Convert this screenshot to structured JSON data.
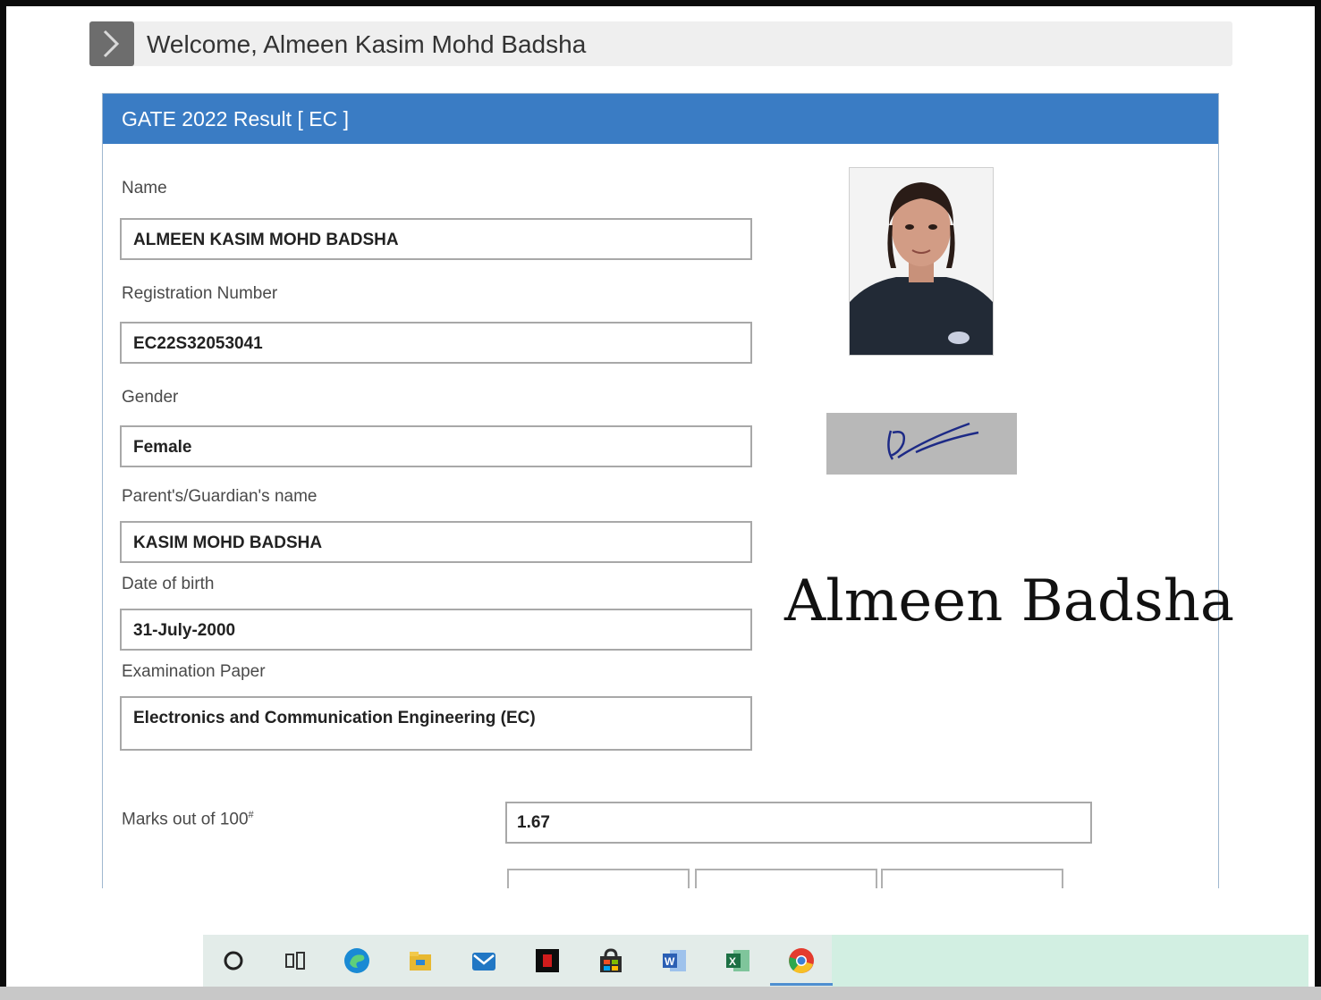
{
  "header": {
    "welcome_text": "Welcome, Almeen Kasim Mohd Badsha"
  },
  "result_panel": {
    "title": "GATE 2022 Result [ EC ]",
    "fields": [
      {
        "label": "Name",
        "value": "ALMEEN KASIM MOHD BADSHA"
      },
      {
        "label": "Registration Number",
        "value": "EC22S32053041"
      },
      {
        "label": "Gender",
        "value": "Female"
      },
      {
        "label": "Parent's/Guardian's name",
        "value": "KASIM MOHD BADSHA"
      },
      {
        "label": "Date of birth",
        "value": "31-July-2000"
      },
      {
        "label": "Examination Paper",
        "value": "Electronics and Communication Engineering (EC)"
      }
    ],
    "marks": {
      "label": "Marks out of 100",
      "label_marker": "#",
      "value": "1.67"
    }
  },
  "overlay": {
    "handwritten_name": "Almeen Badsha"
  },
  "taskbar": {
    "icons": [
      "search-icon",
      "task-view-icon",
      "edge-icon",
      "file-explorer-icon",
      "mail-icon",
      "acrobat-icon",
      "store-icon",
      "word-icon",
      "excel-icon",
      "chrome-icon"
    ]
  },
  "colors": {
    "header_blue": "#3a7cc4",
    "welcome_bar": "#efefef",
    "arrow_gray": "#6d6d6d",
    "taskbar": "#e3ece9"
  }
}
